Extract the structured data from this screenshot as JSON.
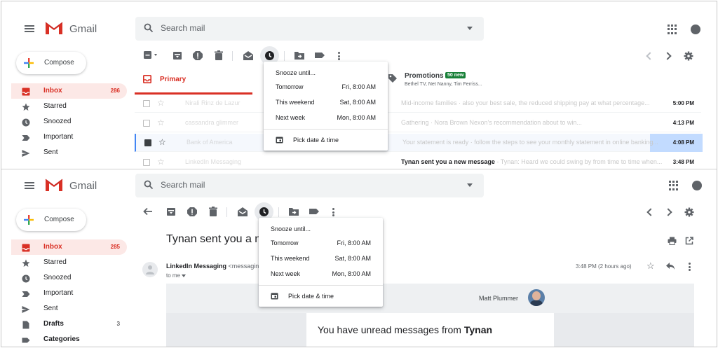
{
  "app": {
    "brand": "Gmail"
  },
  "search": {
    "placeholder": "Search mail"
  },
  "compose": {
    "label": "Compose"
  },
  "colors": {
    "accent": "#d93025",
    "selected_row": "#c2dbff",
    "promo_badge": "#188038"
  },
  "top_pane": {
    "nav": [
      {
        "label": "Inbox",
        "count": "286",
        "icon": "inbox-icon",
        "active": true
      },
      {
        "label": "Starred",
        "icon": "star-icon"
      },
      {
        "label": "Snoozed",
        "icon": "clock-icon"
      },
      {
        "label": "Important",
        "icon": "important-icon"
      },
      {
        "label": "Sent",
        "icon": "send-icon"
      }
    ],
    "tabs": {
      "primary": "Primary",
      "promotions": {
        "label": "Promotions",
        "badge": "50 new",
        "subtitle": "Bethel TV, Net Nanny, Tim Ferriss..."
      }
    },
    "rows": [
      {
        "from": "Nirali Rinz de Lazur",
        "snippet": "Mid-income families · also your best sale, the reduced shipping pay at what percentage...",
        "time": "5:00 PM"
      },
      {
        "from": "cassandra glimmer",
        "snippet": "Gathering · Nora Brown Nexon's recommendation about to win...",
        "time": "4:13 PM"
      },
      {
        "from": "Bank of America",
        "snippet": "Your statement is ready · follow the steps to see your monthly statement in online banking...",
        "time": "4:08 PM",
        "selected": true
      },
      {
        "from": "LinkedIn Messaging",
        "snippet_bold": "Tynan sent you a new message",
        "snippet": " - Tynan: Heard we could swing by from time to time when...",
        "time": "3:48 PM"
      }
    ],
    "snooze_menu": {
      "header": "Snooze until...",
      "options": [
        {
          "label": "Tomorrow",
          "value": "Fri, 8:00 AM"
        },
        {
          "label": "This weekend",
          "value": "Sat, 8:00 AM"
        },
        {
          "label": "Next week",
          "value": "Mon, 8:00 AM"
        }
      ],
      "pick": "Pick date & time"
    }
  },
  "bottom_pane": {
    "nav": [
      {
        "label": "Inbox",
        "count": "285",
        "icon": "inbox-icon",
        "active": true
      },
      {
        "label": "Starred",
        "icon": "star-icon"
      },
      {
        "label": "Snoozed",
        "icon": "clock-icon"
      },
      {
        "label": "Important",
        "icon": "important-icon"
      },
      {
        "label": "Sent",
        "icon": "send-icon"
      },
      {
        "label": "Drafts",
        "count": "3",
        "icon": "draft-icon",
        "bold": true
      },
      {
        "label": "Categories",
        "icon": "label-icon",
        "bold": true
      }
    ],
    "email": {
      "subject": "Tynan sent you a ne",
      "sender_name": "LinkedIn Messaging",
      "sender_addr": "<messagin",
      "to": "to me",
      "time": "3:48 PM (2 hours ago)",
      "card_name": "Matt Plummer",
      "headline_prefix": "You have unread messages from ",
      "headline_name": "Tynan"
    },
    "snooze_menu": {
      "header": "Snooze until...",
      "options": [
        {
          "label": "Tomorrow",
          "value": "Fri, 8:00 AM"
        },
        {
          "label": "This weekend",
          "value": "Sat, 8:00 AM"
        },
        {
          "label": "Next week",
          "value": "Mon, 8:00 AM"
        }
      ],
      "pick": "Pick date & time"
    }
  }
}
